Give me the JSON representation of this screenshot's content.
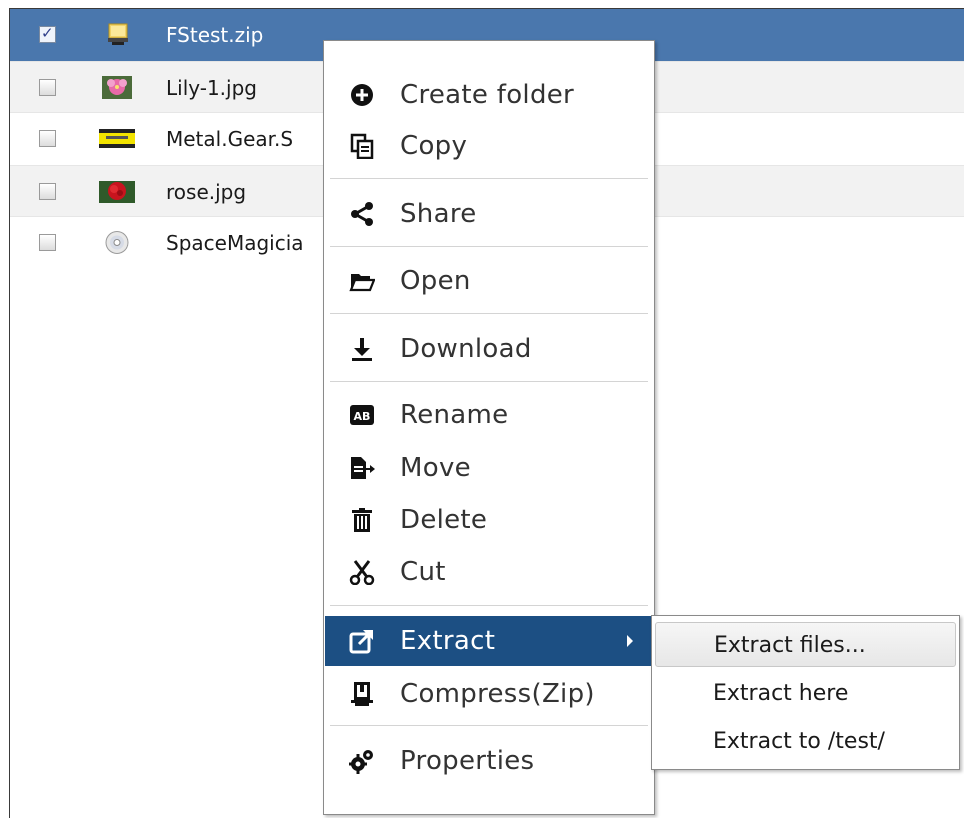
{
  "files": [
    {
      "name": "FStest.zip",
      "checked": true,
      "icon": "zip-archive-icon",
      "selected": true
    },
    {
      "name": "Lily-1.jpg",
      "checked": false,
      "icon": "lily-image-thumbnail",
      "selected": false
    },
    {
      "name": "Metal.Gear.S",
      "checked": false,
      "icon": "metal-gear-image-thumbnail",
      "selected": false
    },
    {
      "name": "rose.jpg",
      "checked": false,
      "icon": "rose-image-thumbnail",
      "selected": false
    },
    {
      "name": "SpaceMagicia",
      "checked": false,
      "icon": "disc-image-icon",
      "selected": false
    }
  ],
  "context_menu": {
    "items": [
      {
        "label": "Create folder",
        "icon": "plus-circle-icon"
      },
      {
        "label": "Copy",
        "icon": "copy-icon"
      },
      {
        "label": "Share",
        "icon": "share-icon"
      },
      {
        "label": "Open",
        "icon": "folder-open-icon"
      },
      {
        "label": "Download",
        "icon": "download-icon"
      },
      {
        "label": "Rename",
        "icon": "rename-ab-icon"
      },
      {
        "label": "Move",
        "icon": "move-icon"
      },
      {
        "label": "Delete",
        "icon": "trash-icon"
      },
      {
        "label": "Cut",
        "icon": "scissors-icon"
      },
      {
        "label": "Extract",
        "icon": "external-link-icon",
        "active": true,
        "has_submenu": true
      },
      {
        "label": "Compress(Zip)",
        "icon": "compress-zip-icon"
      },
      {
        "label": "Properties",
        "icon": "gears-icon"
      }
    ]
  },
  "extract_submenu": {
    "items": [
      {
        "label": "Extract files...",
        "hover": true
      },
      {
        "label": "Extract here"
      },
      {
        "label": "Extract to /test/"
      }
    ]
  },
  "colors": {
    "selected_row": "#4a77ad",
    "active_menu_item": "#1c4f83"
  }
}
